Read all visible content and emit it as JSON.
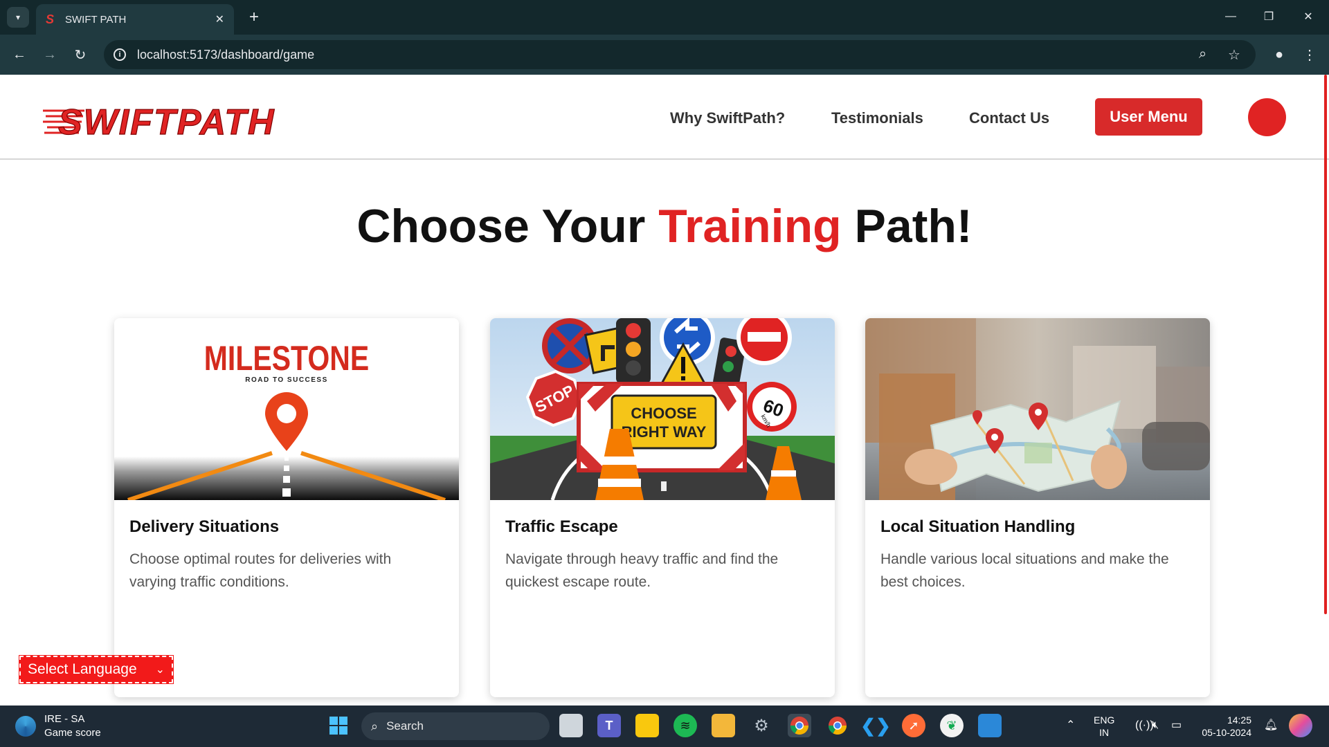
{
  "browser": {
    "tab_title": "SWIFT PATH",
    "url": "localhost:5173/dashboard/game"
  },
  "site": {
    "logo_text": "SWIFTPATH",
    "nav": [
      "Why SwiftPath?",
      "Testimonials",
      "Contact Us"
    ],
    "user_menu_label": "User Menu"
  },
  "hero": {
    "title_part1": "Choose Your ",
    "title_accent": "Training",
    "title_part2": " Path!"
  },
  "cards": [
    {
      "title": "Delivery Situations",
      "description": "Choose optimal routes for deliveries with varying traffic conditions.",
      "image_title": "MILESTONE",
      "image_subtitle": "ROAD TO SUCCESS"
    },
    {
      "title": "Traffic Escape",
      "description": "Navigate through heavy traffic and find the quickest escape route.",
      "image_sign_line1": "CHOOSE",
      "image_sign_line2": "RIGHT WAY",
      "image_stop": "STOP",
      "image_speed": "60",
      "image_speed_unit": "km/h"
    },
    {
      "title": "Local Situation Handling",
      "description": "Handle various local situations and make the best choices."
    }
  ],
  "language_selector": {
    "label": "Select Language"
  },
  "taskbar": {
    "weather_line1": "IRE - SA",
    "weather_line2": "Game score",
    "search_label": "Search",
    "lang_line1": "ENG",
    "lang_line2": "IN",
    "time": "14:25",
    "date": "05-10-2024"
  },
  "colors": {
    "accent": "#e02323",
    "browser_dark": "#13282c",
    "browser_toolbar": "#203a40"
  }
}
